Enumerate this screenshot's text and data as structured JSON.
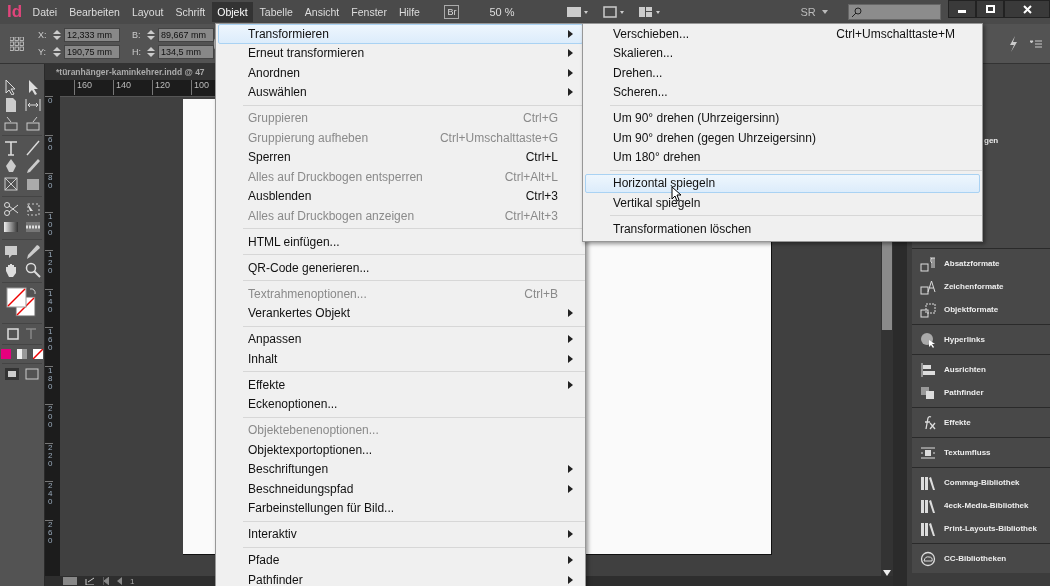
{
  "app": {
    "logo": "Id"
  },
  "menubar": [
    {
      "label": "Datei",
      "selected": false
    },
    {
      "label": "Bearbeiten",
      "selected": false
    },
    {
      "label": "Layout",
      "selected": false
    },
    {
      "label": "Schrift",
      "selected": false
    },
    {
      "label": "Objekt",
      "selected": true
    },
    {
      "label": "Tabelle",
      "selected": false
    },
    {
      "label": "Ansicht",
      "selected": false
    },
    {
      "label": "Fenster",
      "selected": false
    },
    {
      "label": "Hilfe",
      "selected": false
    }
  ],
  "toolbar": {
    "bridge": "Br",
    "zoom": "50 %",
    "workspace": "SR"
  },
  "control": {
    "fields": [
      {
        "label": "X:",
        "value": "12,333 mm"
      },
      {
        "label": "Y:",
        "value": "190,75 mm"
      },
      {
        "label": "B:",
        "value": "89,667 mm"
      },
      {
        "label": "H:",
        "value": "134,5 mm"
      }
    ]
  },
  "document": {
    "tab": "*türanhänger-kaminkehrer.indd @ 47",
    "ruler_h": [
      "160",
      "140",
      "120",
      "100"
    ],
    "ruler_v": [
      "0",
      "60",
      "80",
      "100",
      "120",
      "140",
      "160",
      "180",
      "200",
      "220",
      "240",
      "260"
    ],
    "page_number": "1"
  },
  "menu": {
    "items": [
      {
        "kind": "item",
        "label": "Transformieren",
        "has_submenu": true,
        "disabled": false,
        "selected": true
      },
      {
        "kind": "item",
        "label": "Erneut transformieren",
        "has_submenu": true,
        "disabled": false,
        "selected": false
      },
      {
        "kind": "item",
        "label": "Anordnen",
        "has_submenu": true,
        "disabled": false,
        "selected": false
      },
      {
        "kind": "item",
        "label": "Auswählen",
        "has_submenu": true,
        "disabled": false,
        "selected": false
      },
      {
        "kind": "separator"
      },
      {
        "kind": "item",
        "label": "Gruppieren",
        "shortcut": "Ctrl+G",
        "has_submenu": false,
        "disabled": true,
        "selected": false
      },
      {
        "kind": "item",
        "label": "Gruppierung aufheben",
        "shortcut": "Ctrl+Umschalttaste+G",
        "has_submenu": false,
        "disabled": true,
        "selected": false
      },
      {
        "kind": "item",
        "label": "Sperren",
        "shortcut": "Ctrl+L",
        "has_submenu": false,
        "disabled": false,
        "selected": false
      },
      {
        "kind": "item",
        "label": "Alles auf Druckbogen entsperren",
        "shortcut": "Ctrl+Alt+L",
        "has_submenu": false,
        "disabled": true,
        "selected": false
      },
      {
        "kind": "item",
        "label": "Ausblenden",
        "shortcut": "Ctrl+3",
        "has_submenu": false,
        "disabled": false,
        "selected": false
      },
      {
        "kind": "item",
        "label": "Alles auf Druckbogen anzeigen",
        "shortcut": "Ctrl+Alt+3",
        "has_submenu": false,
        "disabled": true,
        "selected": false
      },
      {
        "kind": "separator"
      },
      {
        "kind": "item",
        "label": "HTML einfügen...",
        "has_submenu": false,
        "disabled": false,
        "selected": false
      },
      {
        "kind": "separator"
      },
      {
        "kind": "item",
        "label": "QR-Code generieren...",
        "has_submenu": false,
        "disabled": false,
        "selected": false
      },
      {
        "kind": "separator"
      },
      {
        "kind": "item",
        "label": "Textrahmenoptionen...",
        "shortcut": "Ctrl+B",
        "has_submenu": false,
        "disabled": true,
        "selected": false
      },
      {
        "kind": "item",
        "label": "Verankertes Objekt",
        "has_submenu": true,
        "disabled": false,
        "selected": false
      },
      {
        "kind": "separator"
      },
      {
        "kind": "item",
        "label": "Anpassen",
        "has_submenu": true,
        "disabled": false,
        "selected": false
      },
      {
        "kind": "item",
        "label": "Inhalt",
        "has_submenu": true,
        "disabled": false,
        "selected": false
      },
      {
        "kind": "separator"
      },
      {
        "kind": "item",
        "label": "Effekte",
        "has_submenu": true,
        "disabled": false,
        "selected": false
      },
      {
        "kind": "item",
        "label": "Eckenoptionen...",
        "has_submenu": false,
        "disabled": false,
        "selected": false
      },
      {
        "kind": "separator"
      },
      {
        "kind": "item",
        "label": "Objektebenenoptionen...",
        "has_submenu": false,
        "disabled": true,
        "selected": false
      },
      {
        "kind": "item",
        "label": "Objektexportoptionen...",
        "has_submenu": false,
        "disabled": false,
        "selected": false
      },
      {
        "kind": "item",
        "label": "Beschriftungen",
        "has_submenu": true,
        "disabled": false,
        "selected": false
      },
      {
        "kind": "item",
        "label": "Beschneidungspfad",
        "has_submenu": true,
        "disabled": false,
        "selected": false
      },
      {
        "kind": "item",
        "label": "Farbeinstellungen für Bild...",
        "has_submenu": false,
        "disabled": false,
        "selected": false
      },
      {
        "kind": "separator"
      },
      {
        "kind": "item",
        "label": "Interaktiv",
        "has_submenu": true,
        "disabled": false,
        "selected": false
      },
      {
        "kind": "separator"
      },
      {
        "kind": "item",
        "label": "Pfade",
        "has_submenu": true,
        "disabled": false,
        "selected": false
      },
      {
        "kind": "item",
        "label": "Pathfinder",
        "has_submenu": true,
        "disabled": false,
        "selected": false
      }
    ]
  },
  "submenu": {
    "items": [
      {
        "kind": "item",
        "label": "Verschieben...",
        "shortcut": "Ctrl+Umschalttaste+M",
        "disabled": false,
        "selected": false
      },
      {
        "kind": "item",
        "label": "Skalieren...",
        "disabled": false,
        "selected": false
      },
      {
        "kind": "item",
        "label": "Drehen...",
        "disabled": false,
        "selected": false
      },
      {
        "kind": "item",
        "label": "Scheren...",
        "disabled": false,
        "selected": false
      },
      {
        "kind": "separator"
      },
      {
        "kind": "item",
        "label": "Um 90° drehen (Uhrzeigersinn)",
        "disabled": false,
        "selected": false
      },
      {
        "kind": "item",
        "label": "Um 90° drehen (gegen Uhrzeigersinn)",
        "disabled": false,
        "selected": false
      },
      {
        "kind": "item",
        "label": "Um 180° drehen",
        "disabled": false,
        "selected": false
      },
      {
        "kind": "separator"
      },
      {
        "kind": "item",
        "label": "Horizontal spiegeln",
        "disabled": false,
        "selected": true
      },
      {
        "kind": "item",
        "label": "Vertikal spiegeln",
        "disabled": false,
        "selected": false
      },
      {
        "kind": "separator"
      },
      {
        "kind": "item",
        "label": "Transformationen löschen",
        "disabled": false,
        "selected": false
      }
    ]
  },
  "panels": {
    "top_label": "gen",
    "groups": [
      {
        "items": [
          {
            "label": "Absatzformate"
          },
          {
            "label": "Zeichenformate"
          },
          {
            "label": "Objektformate"
          }
        ]
      },
      {
        "items": [
          {
            "label": "Hyperlinks"
          }
        ]
      },
      {
        "items": [
          {
            "label": "Ausrichten"
          },
          {
            "label": "Pathfinder"
          }
        ]
      },
      {
        "items": [
          {
            "label": "Effekte"
          }
        ]
      },
      {
        "items": [
          {
            "label": "Textumfluss"
          }
        ]
      },
      {
        "items": [
          {
            "label": "Commag-Bibliothek"
          },
          {
            "label": "4eck-Media-Bibliothek"
          },
          {
            "label": "Print-Layouts-Bibliothek"
          }
        ]
      },
      {
        "items": [
          {
            "label": "CC-Bibliotheken"
          }
        ]
      }
    ]
  }
}
